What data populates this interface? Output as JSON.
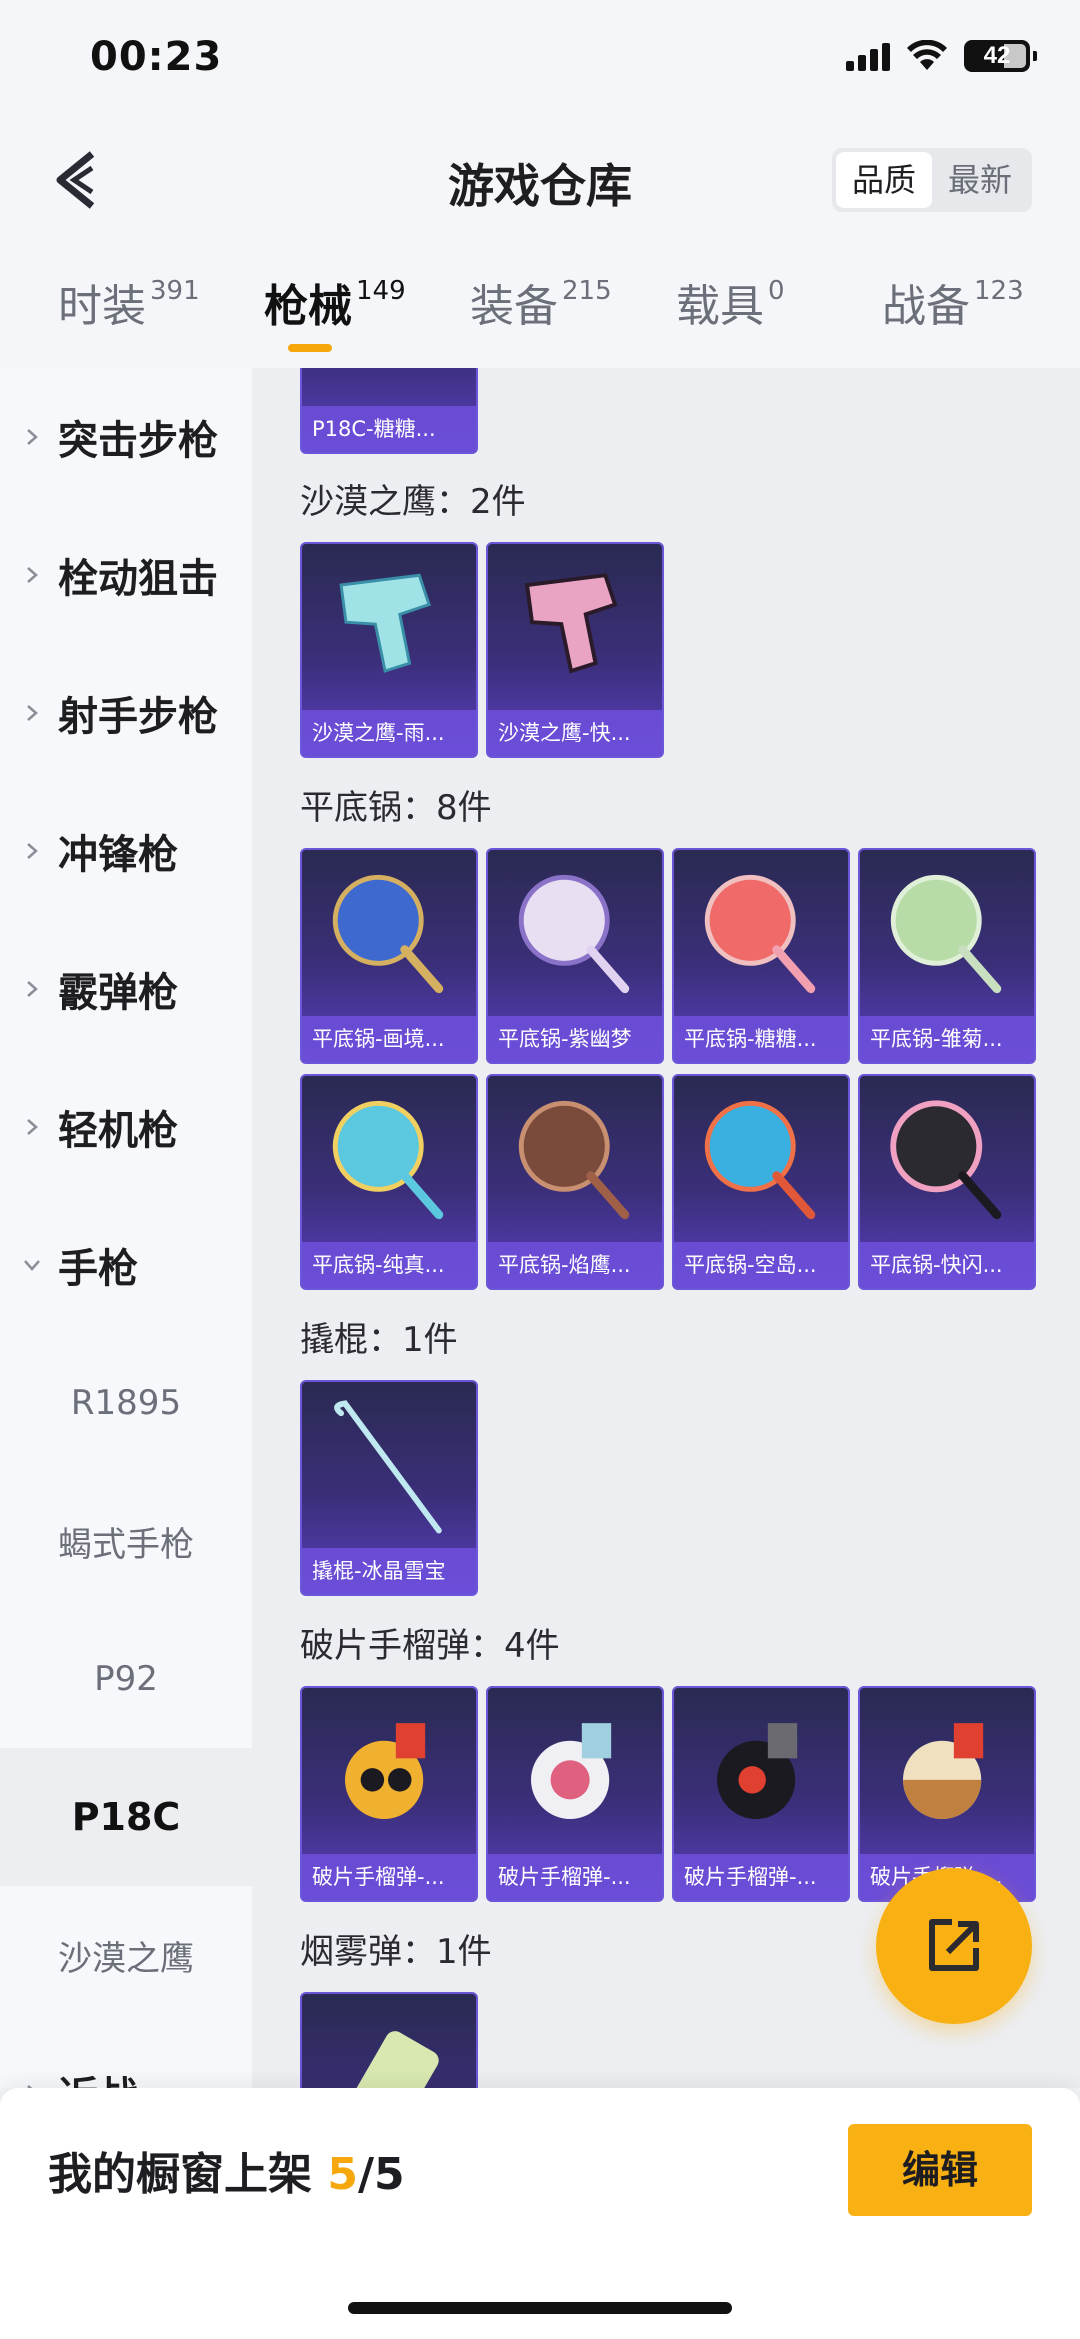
{
  "status_bar": {
    "time": "00:23",
    "battery": "42"
  },
  "header": {
    "title": "游戏仓库",
    "sort_options": [
      "品质",
      "最新"
    ]
  },
  "tabs": [
    {
      "label": "时装",
      "count": "391"
    },
    {
      "label": "枪械",
      "count": "149"
    },
    {
      "label": "装备",
      "count": "215"
    },
    {
      "label": "载具",
      "count": "0"
    },
    {
      "label": "战备",
      "count": "123"
    }
  ],
  "sidebar": {
    "categories": [
      "突击步枪",
      "栓动狙击",
      "射手步枪",
      "冲锋枪",
      "霰弹枪",
      "轻机枪",
      "手枪"
    ],
    "pistol_sub": [
      "R1895",
      "蝎式手枪",
      "P92",
      "P18C",
      "沙漠之鹰"
    ],
    "next_category": "近战"
  },
  "content": {
    "prev_card": "P18C-糖糖...",
    "groups": [
      {
        "title": "沙漠之鹰：2件",
        "items": [
          "沙漠之鹰-雨...",
          "沙漠之鹰-快..."
        ]
      },
      {
        "title": "平底锅：8件",
        "items": [
          "平底锅-画境...",
          "平底锅-紫幽梦",
          "平底锅-糖糖...",
          "平底锅-雏菊...",
          "平底锅-纯真...",
          "平底锅-焰鹰...",
          "平底锅-空岛...",
          "平底锅-快闪..."
        ]
      },
      {
        "title": "撬棍：1件",
        "items": [
          "撬棍-冰晶雪宝"
        ]
      },
      {
        "title": "破片手榴弹：4件",
        "items": [
          "破片手榴弹-...",
          "破片手榴弹-...",
          "破片手榴弹-...",
          "破片手榴弹-..."
        ]
      },
      {
        "title": "烟雾弹：1件",
        "items": [
          ""
        ]
      }
    ]
  },
  "bottom": {
    "label": "我的橱窗上架 ",
    "count": "5",
    "total": "/5",
    "edit": "编辑"
  },
  "colors": {
    "accent": "#f8b013",
    "card_purple": "#5a3fc0"
  }
}
